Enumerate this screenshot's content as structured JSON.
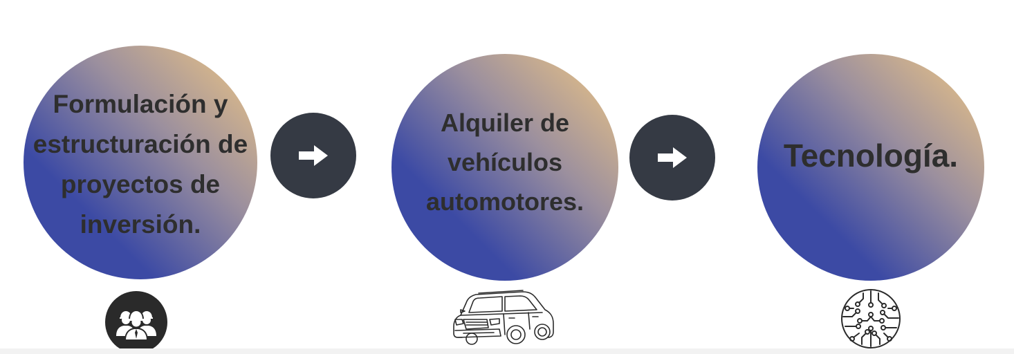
{
  "steps": [
    {
      "label": "Formulación y estructuración de proyectos de inversión.",
      "icon": "team-workers-icon"
    },
    {
      "label": "Alquiler de vehículos automotores.",
      "icon": "car-icon"
    },
    {
      "label": "Tecnología.",
      "icon": "circuit-brain-icon"
    }
  ],
  "connectors": [
    {
      "icon": "arrow-right-icon"
    },
    {
      "icon": "arrow-right-icon"
    }
  ],
  "colors": {
    "gradient_start": "#3c4aa4",
    "gradient_end": "#e5c087",
    "arrow_bg": "#353a44",
    "text": "#2e2e2e",
    "icon": "#2a2a2a"
  }
}
